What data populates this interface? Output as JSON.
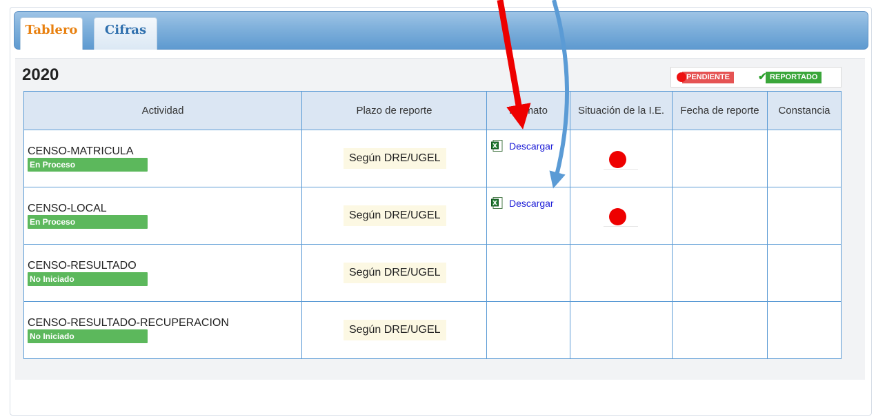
{
  "tabs": [
    {
      "label": "Tablero",
      "active": true
    },
    {
      "label": "Cifras",
      "active": false
    }
  ],
  "year": "2020",
  "legend": {
    "pending": "PENDIENTE",
    "reported": "REPORTADO",
    "pending_color": "#e55353",
    "reported_color": "#3aa63a"
  },
  "table": {
    "headers": [
      "Actividad",
      "Plazo de reporte",
      "Formato",
      "Situación de la I.E.",
      "Fecha de reporte",
      "Constancia"
    ],
    "rows": [
      {
        "actividad": "CENSO-MATRICULA",
        "estado": "En Proceso",
        "plazo": "Según DRE/UGEL",
        "formato": "Descargar",
        "situacion": "pendiente"
      },
      {
        "actividad": "CENSO-LOCAL",
        "estado": "En Proceso",
        "plazo": "Según DRE/UGEL",
        "formato": "Descargar",
        "situacion": "pendiente"
      },
      {
        "actividad": "CENSO-RESULTADO",
        "estado": "No Iniciado",
        "plazo": "Según DRE/UGEL",
        "formato": "",
        "situacion": ""
      },
      {
        "actividad": "CENSO-RESULTADO-RECUPERACION",
        "estado": "No Iniciado",
        "plazo": "Según DRE/UGEL",
        "formato": "",
        "situacion": ""
      }
    ]
  },
  "annotations": {
    "red_arrow_color": "#ee0000",
    "blue_arrow_color": "#5b9bd5"
  }
}
